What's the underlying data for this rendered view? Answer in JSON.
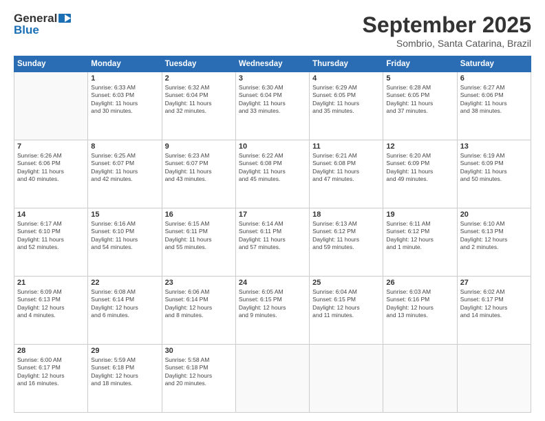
{
  "header": {
    "logo_general": "General",
    "logo_blue": "Blue",
    "month_title": "September 2025",
    "subtitle": "Sombrio, Santa Catarina, Brazil"
  },
  "weekdays": [
    "Sunday",
    "Monday",
    "Tuesday",
    "Wednesday",
    "Thursday",
    "Friday",
    "Saturday"
  ],
  "weeks": [
    [
      {
        "day": "",
        "sunrise": "",
        "sunset": "",
        "daylight": ""
      },
      {
        "day": "1",
        "sunrise": "Sunrise: 6:33 AM",
        "sunset": "Sunset: 6:03 PM",
        "daylight": "Daylight: 11 hours and 30 minutes."
      },
      {
        "day": "2",
        "sunrise": "Sunrise: 6:32 AM",
        "sunset": "Sunset: 6:04 PM",
        "daylight": "Daylight: 11 hours and 32 minutes."
      },
      {
        "day": "3",
        "sunrise": "Sunrise: 6:30 AM",
        "sunset": "Sunset: 6:04 PM",
        "daylight": "Daylight: 11 hours and 33 minutes."
      },
      {
        "day": "4",
        "sunrise": "Sunrise: 6:29 AM",
        "sunset": "Sunset: 6:05 PM",
        "daylight": "Daylight: 11 hours and 35 minutes."
      },
      {
        "day": "5",
        "sunrise": "Sunrise: 6:28 AM",
        "sunset": "Sunset: 6:05 PM",
        "daylight": "Daylight: 11 hours and 37 minutes."
      },
      {
        "day": "6",
        "sunrise": "Sunrise: 6:27 AM",
        "sunset": "Sunset: 6:06 PM",
        "daylight": "Daylight: 11 hours and 38 minutes."
      }
    ],
    [
      {
        "day": "7",
        "sunrise": "Sunrise: 6:26 AM",
        "sunset": "Sunset: 6:06 PM",
        "daylight": "Daylight: 11 hours and 40 minutes."
      },
      {
        "day": "8",
        "sunrise": "Sunrise: 6:25 AM",
        "sunset": "Sunset: 6:07 PM",
        "daylight": "Daylight: 11 hours and 42 minutes."
      },
      {
        "day": "9",
        "sunrise": "Sunrise: 6:23 AM",
        "sunset": "Sunset: 6:07 PM",
        "daylight": "Daylight: 11 hours and 43 minutes."
      },
      {
        "day": "10",
        "sunrise": "Sunrise: 6:22 AM",
        "sunset": "Sunset: 6:08 PM",
        "daylight": "Daylight: 11 hours and 45 minutes."
      },
      {
        "day": "11",
        "sunrise": "Sunrise: 6:21 AM",
        "sunset": "Sunset: 6:08 PM",
        "daylight": "Daylight: 11 hours and 47 minutes."
      },
      {
        "day": "12",
        "sunrise": "Sunrise: 6:20 AM",
        "sunset": "Sunset: 6:09 PM",
        "daylight": "Daylight: 11 hours and 49 minutes."
      },
      {
        "day": "13",
        "sunrise": "Sunrise: 6:19 AM",
        "sunset": "Sunset: 6:09 PM",
        "daylight": "Daylight: 11 hours and 50 minutes."
      }
    ],
    [
      {
        "day": "14",
        "sunrise": "Sunrise: 6:17 AM",
        "sunset": "Sunset: 6:10 PM",
        "daylight": "Daylight: 11 hours and 52 minutes."
      },
      {
        "day": "15",
        "sunrise": "Sunrise: 6:16 AM",
        "sunset": "Sunset: 6:10 PM",
        "daylight": "Daylight: 11 hours and 54 minutes."
      },
      {
        "day": "16",
        "sunrise": "Sunrise: 6:15 AM",
        "sunset": "Sunset: 6:11 PM",
        "daylight": "Daylight: 11 hours and 55 minutes."
      },
      {
        "day": "17",
        "sunrise": "Sunrise: 6:14 AM",
        "sunset": "Sunset: 6:11 PM",
        "daylight": "Daylight: 11 hours and 57 minutes."
      },
      {
        "day": "18",
        "sunrise": "Sunrise: 6:13 AM",
        "sunset": "Sunset: 6:12 PM",
        "daylight": "Daylight: 11 hours and 59 minutes."
      },
      {
        "day": "19",
        "sunrise": "Sunrise: 6:11 AM",
        "sunset": "Sunset: 6:12 PM",
        "daylight": "Daylight: 12 hours and 1 minute."
      },
      {
        "day": "20",
        "sunrise": "Sunrise: 6:10 AM",
        "sunset": "Sunset: 6:13 PM",
        "daylight": "Daylight: 12 hours and 2 minutes."
      }
    ],
    [
      {
        "day": "21",
        "sunrise": "Sunrise: 6:09 AM",
        "sunset": "Sunset: 6:13 PM",
        "daylight": "Daylight: 12 hours and 4 minutes."
      },
      {
        "day": "22",
        "sunrise": "Sunrise: 6:08 AM",
        "sunset": "Sunset: 6:14 PM",
        "daylight": "Daylight: 12 hours and 6 minutes."
      },
      {
        "day": "23",
        "sunrise": "Sunrise: 6:06 AM",
        "sunset": "Sunset: 6:14 PM",
        "daylight": "Daylight: 12 hours and 8 minutes."
      },
      {
        "day": "24",
        "sunrise": "Sunrise: 6:05 AM",
        "sunset": "Sunset: 6:15 PM",
        "daylight": "Daylight: 12 hours and 9 minutes."
      },
      {
        "day": "25",
        "sunrise": "Sunrise: 6:04 AM",
        "sunset": "Sunset: 6:15 PM",
        "daylight": "Daylight: 12 hours and 11 minutes."
      },
      {
        "day": "26",
        "sunrise": "Sunrise: 6:03 AM",
        "sunset": "Sunset: 6:16 PM",
        "daylight": "Daylight: 12 hours and 13 minutes."
      },
      {
        "day": "27",
        "sunrise": "Sunrise: 6:02 AM",
        "sunset": "Sunset: 6:17 PM",
        "daylight": "Daylight: 12 hours and 14 minutes."
      }
    ],
    [
      {
        "day": "28",
        "sunrise": "Sunrise: 6:00 AM",
        "sunset": "Sunset: 6:17 PM",
        "daylight": "Daylight: 12 hours and 16 minutes."
      },
      {
        "day": "29",
        "sunrise": "Sunrise: 5:59 AM",
        "sunset": "Sunset: 6:18 PM",
        "daylight": "Daylight: 12 hours and 18 minutes."
      },
      {
        "day": "30",
        "sunrise": "Sunrise: 5:58 AM",
        "sunset": "Sunset: 6:18 PM",
        "daylight": "Daylight: 12 hours and 20 minutes."
      },
      {
        "day": "",
        "sunrise": "",
        "sunset": "",
        "daylight": ""
      },
      {
        "day": "",
        "sunrise": "",
        "sunset": "",
        "daylight": ""
      },
      {
        "day": "",
        "sunrise": "",
        "sunset": "",
        "daylight": ""
      },
      {
        "day": "",
        "sunrise": "",
        "sunset": "",
        "daylight": ""
      }
    ]
  ]
}
